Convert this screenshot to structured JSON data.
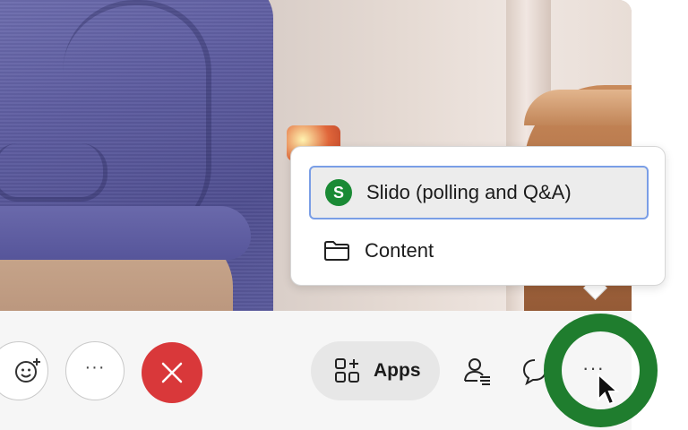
{
  "video": {
    "participant": ""
  },
  "popup_menu": {
    "items": [
      {
        "label": "Slido (polling and Q&A)",
        "badge": "S",
        "icon": "slido-icon",
        "selected": true
      },
      {
        "label": "Content",
        "icon": "folder-icon",
        "selected": false
      }
    ]
  },
  "toolbar": {
    "reactions_icon": "emoji-add-icon",
    "more_inline_label": "···",
    "end_call_icon": "close-icon",
    "apps_label": "Apps",
    "participants_icon": "participants-icon",
    "chat_icon": "chat-icon",
    "more_label": "···"
  },
  "colors": {
    "end_call": "#d9383a",
    "slido_green": "#1a8a35",
    "highlight_ring": "#1f7d2e",
    "selection_border": "#7a9ee6"
  }
}
